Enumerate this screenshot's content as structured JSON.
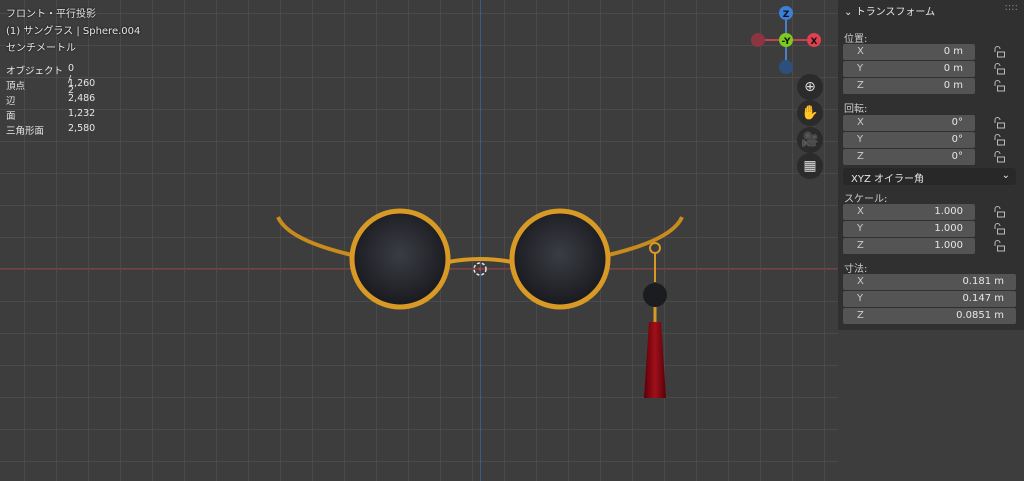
{
  "viewport": {
    "view_name": "フロント・平行投影",
    "object_name": "(1) サングラス | Sphere.004",
    "units": "センチメートル",
    "stats": [
      {
        "label": "オブジェクト",
        "value": "0 / 2"
      },
      {
        "label": "頂点",
        "value": "1,260"
      },
      {
        "label": "辺",
        "value": "2,486"
      },
      {
        "label": "面",
        "value": "1,232"
      },
      {
        "label": "三角形面",
        "value": "2,580"
      }
    ],
    "gizmo": {
      "z": "Z",
      "y": "-Y",
      "x": "X"
    }
  },
  "panel": {
    "title": "トランスフォーム",
    "location": {
      "label": "位置:",
      "x": "0 m",
      "y": "0 m",
      "z": "0 m"
    },
    "rotation": {
      "label": "回転:",
      "x": "0°",
      "y": "0°",
      "z": "0°"
    },
    "rotation_mode": "XYZ オイラー角",
    "scale": {
      "label": "スケール:",
      "x": "1.000",
      "y": "1.000",
      "z": "1.000"
    },
    "dimensions": {
      "label": "寸法:",
      "x": "0.181 m",
      "y": "0.147 m",
      "z": "0.0851 m"
    },
    "axes": [
      "X",
      "Y",
      "Z"
    ]
  }
}
